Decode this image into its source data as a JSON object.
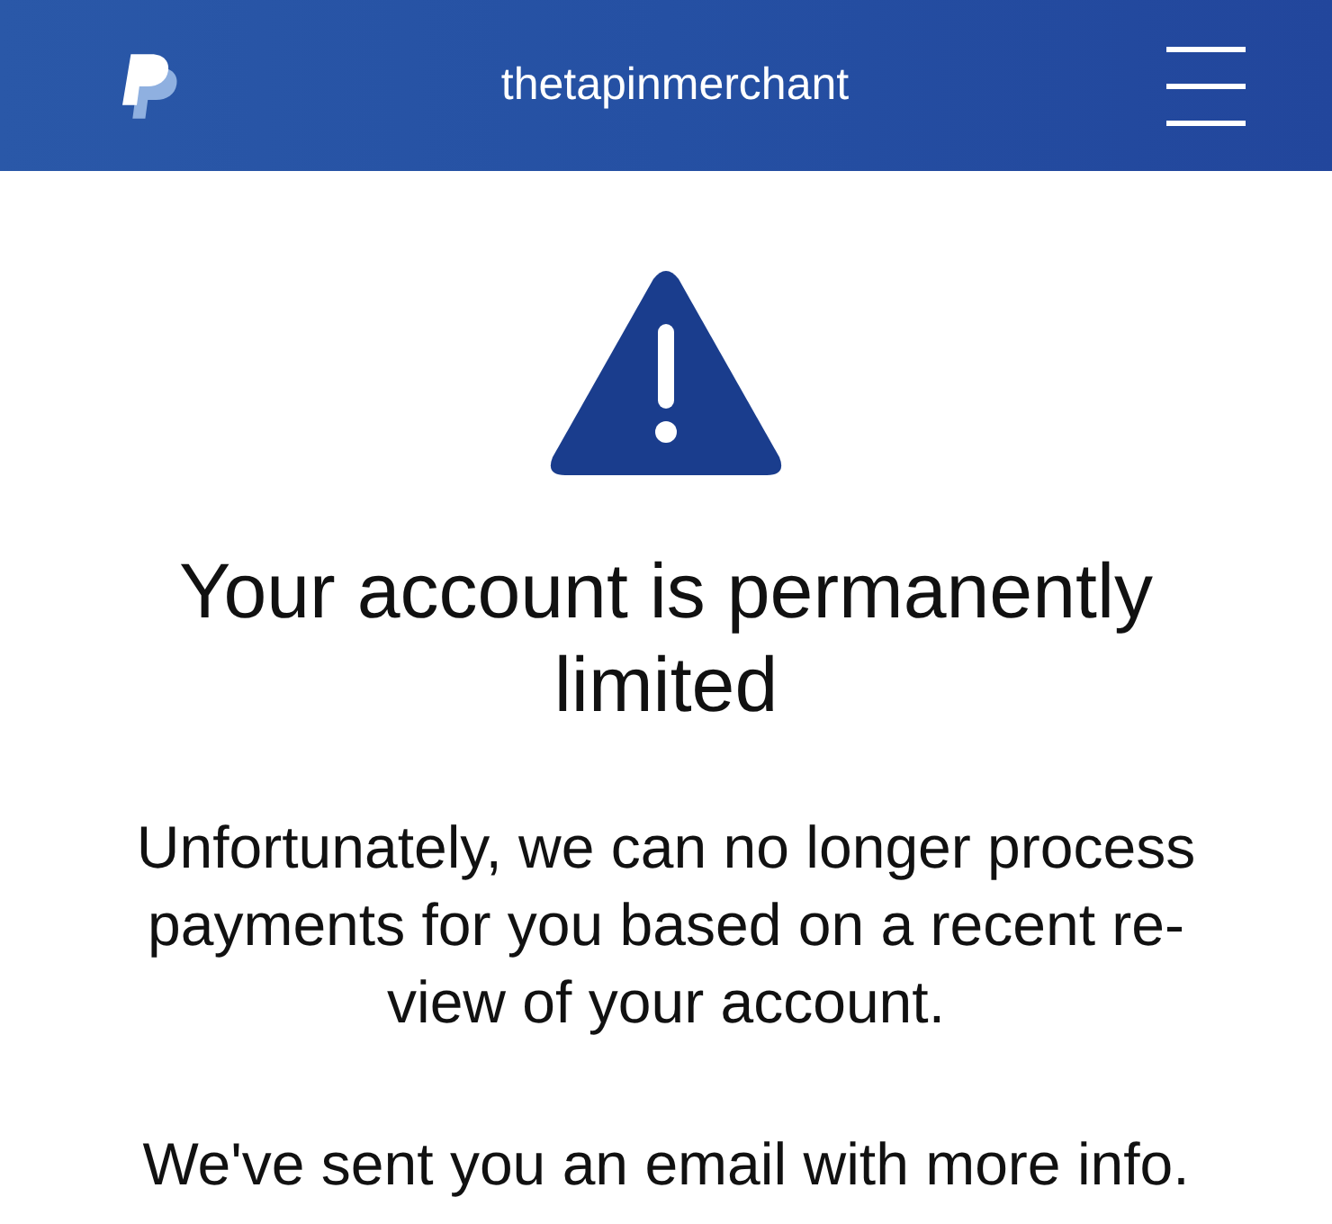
{
  "header": {
    "title": "thetapinmerchant"
  },
  "alert": {
    "heading": "Your account is permanently limited",
    "paragraphs": [
      "Unfortunately, we can no longer process payments for you based on a recent re-view of your account.",
      "We've sent you an email with more info."
    ]
  }
}
